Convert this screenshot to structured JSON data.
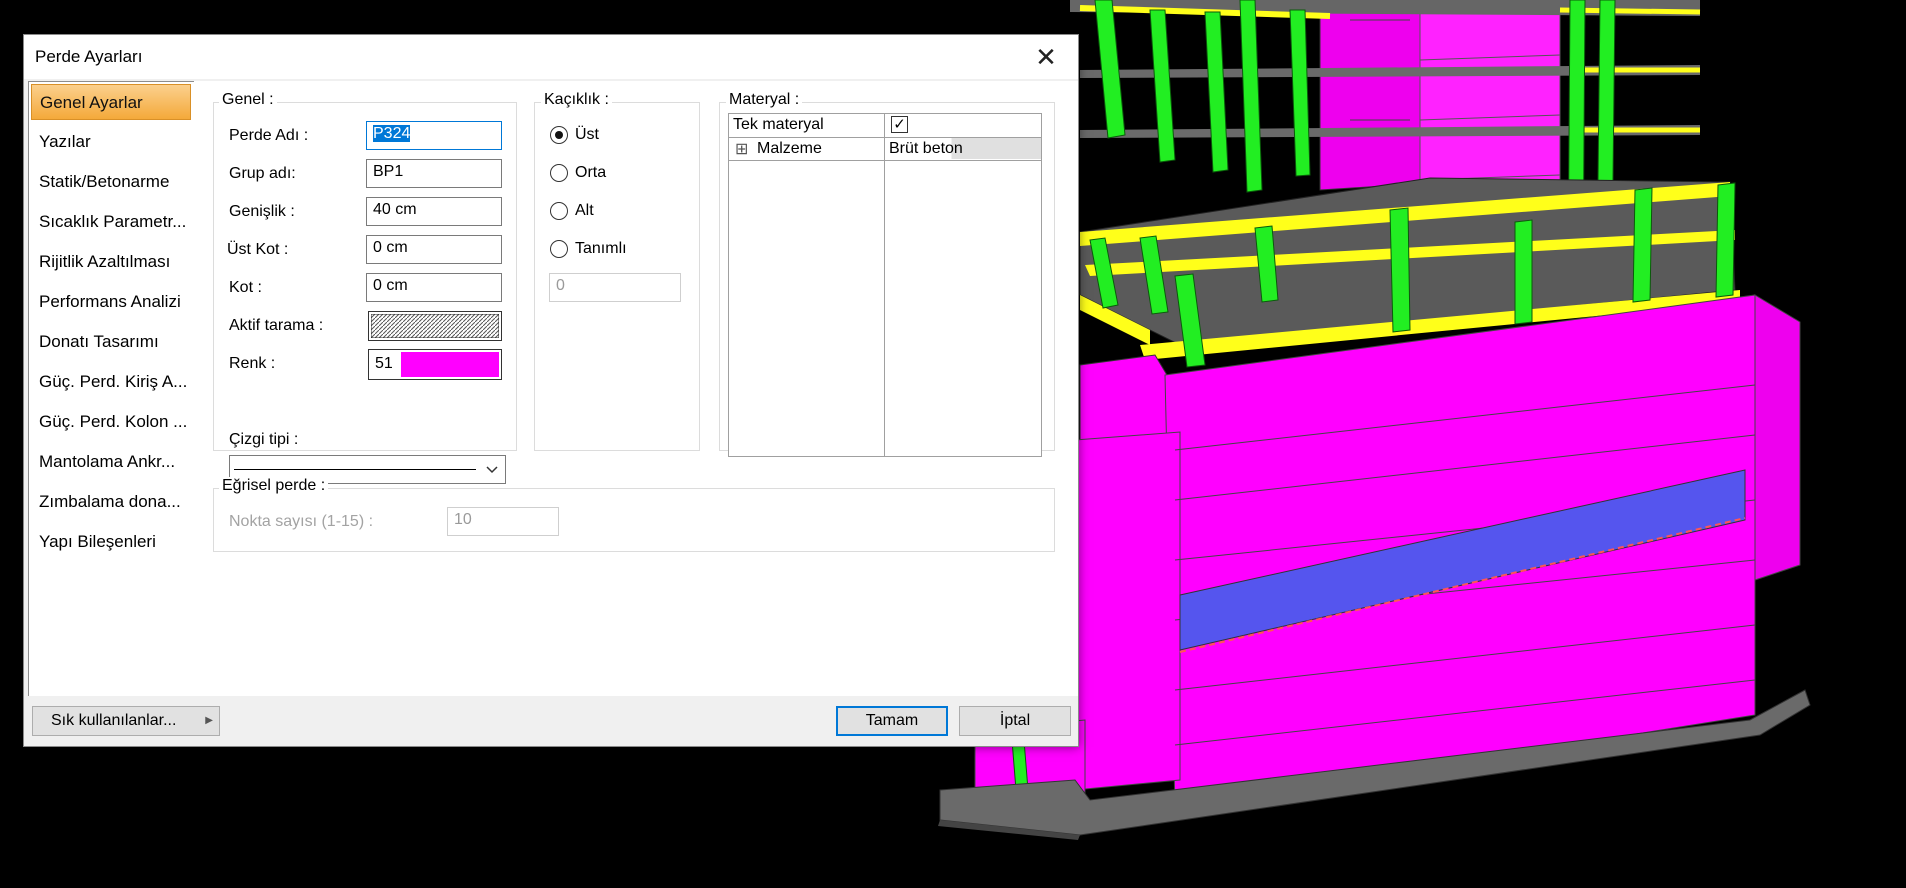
{
  "dialog": {
    "title": "Perde Ayarları",
    "close_glyph": "✕",
    "sidebar": [
      {
        "label": "Genel Ayarlar",
        "active": true
      },
      {
        "label": "Yazılar"
      },
      {
        "label": "Statik/Betonarme"
      },
      {
        "label": "Sıcaklık Parametr..."
      },
      {
        "label": "Rijitlik Azaltılması"
      },
      {
        "label": "Performans Analizi"
      },
      {
        "label": "Donatı Tasarımı"
      },
      {
        "label": "Güç. Perd. Kiriş A..."
      },
      {
        "label": "Güç. Perd. Kolon ..."
      },
      {
        "label": "Mantolama Ankr..."
      },
      {
        "label": "Zımbalama dona..."
      },
      {
        "label": "Yapı Bileşenleri"
      }
    ],
    "genel": {
      "legend": "Genel :",
      "perde_adi_label": "Perde Adı :",
      "perde_adi_value": "P324",
      "grup_adi_label": "Grup adı:",
      "grup_adi_value": "BP1",
      "genislik_label": "Genişlik :",
      "genislik_value": "40 cm",
      "ust_kot_label": "Üst Kot :",
      "ust_kot_value": "0 cm",
      "kot_label": "Kot :",
      "kot_value": "0 cm",
      "aktif_tarama_label": "Aktif tarama :",
      "renk_label": "Renk :",
      "renk_value": "51",
      "renk_color": "#ff00ff",
      "cizgi_tipi_label": "Çizgi tipi :",
      "dropdown_icon": "chevron-down-icon"
    },
    "kaciklik": {
      "legend": "Kaçıklık :",
      "options": [
        {
          "label": "Üst",
          "checked": true
        },
        {
          "label": "Orta",
          "checked": false
        },
        {
          "label": "Alt",
          "checked": false
        },
        {
          "label": "Tanımlı",
          "checked": false
        }
      ],
      "tanimli_value": "0"
    },
    "materyal": {
      "legend": "Materyal :",
      "rows": [
        {
          "name": "Tek materyal",
          "value": "",
          "checkbox": true,
          "checked": true
        },
        {
          "name": "Malzeme",
          "value": "Brüt beton",
          "expander": "⊞"
        }
      ]
    },
    "egrisel": {
      "legend": "Eğrisel perde :",
      "nokta_label": "Nokta sayısı (1-15) :",
      "nokta_value": "10"
    },
    "footer": {
      "favorites_label": "Sık kullanılanlar...",
      "ok_label": "Tamam",
      "cancel_label": "İptal"
    }
  },
  "colors": {
    "wall_magenta": "#ff00ff",
    "column_green": "#22ee22",
    "beam_yellow": "#ffff1a",
    "slab_gray": "#555555",
    "highlight_blue": "#5555ee",
    "sidebar_active": "#f4a93a"
  }
}
